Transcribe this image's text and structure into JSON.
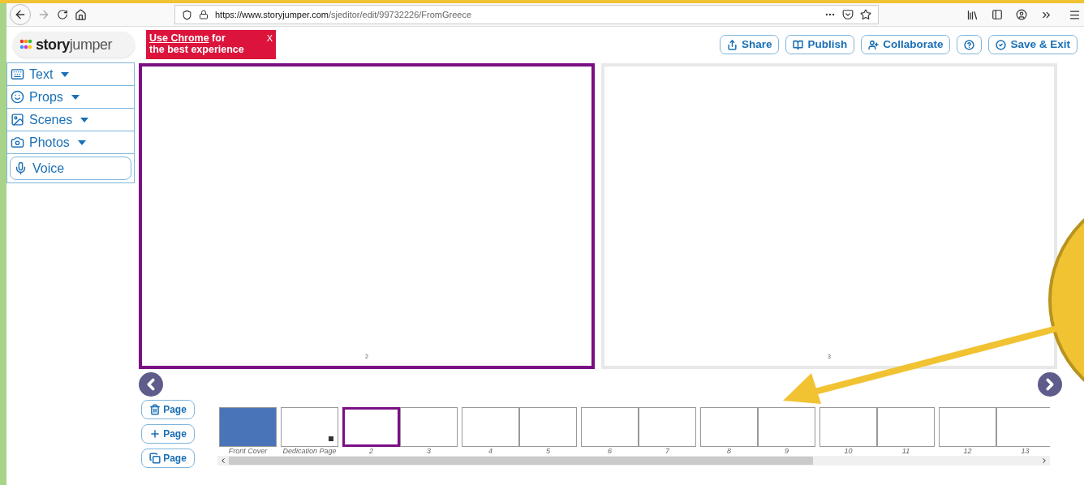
{
  "browser": {
    "url_host": "https://www.storyjumper.com",
    "url_path": "/sjeditor/edit/99732226/FromGreece"
  },
  "banner": {
    "link": "Use Chrome",
    "text_1": " for",
    "text_2": "the best experience",
    "close": "X"
  },
  "logo": {
    "word_1": "story",
    "word_2": "jumper"
  },
  "top_buttons": [
    {
      "kind": "share",
      "label": "Share"
    },
    {
      "kind": "publish",
      "label": "Publish"
    },
    {
      "kind": "collaborate",
      "label": "Collaborate"
    },
    {
      "kind": "help"
    },
    {
      "kind": "save",
      "label": "Save & Exit"
    }
  ],
  "tools": [
    {
      "kind": "text",
      "label": "Text",
      "dropdown": true
    },
    {
      "kind": "props",
      "label": "Props",
      "dropdown": true
    },
    {
      "kind": "scenes",
      "label": "Scenes",
      "dropdown": true
    },
    {
      "kind": "photos",
      "label": "Photos",
      "dropdown": true
    },
    {
      "kind": "voice",
      "label": "Voice",
      "dropdown": false
    }
  ],
  "spread": [
    {
      "number": "2",
      "selected": true
    },
    {
      "number": "3",
      "selected": false
    }
  ],
  "page_buttons": [
    {
      "kind": "delete",
      "label": "Page"
    },
    {
      "kind": "add",
      "label": "Page"
    },
    {
      "kind": "copy",
      "label": "Page"
    }
  ],
  "thumbnails": [
    {
      "kind": "cover",
      "label": "Front Cover",
      "selected": false
    },
    {
      "kind": "dedication",
      "label": "Dedication Page",
      "selected": false
    },
    {
      "kind": "page",
      "label": "2",
      "selected": true
    },
    {
      "kind": "page",
      "label": "3",
      "selected": false
    },
    {
      "kind": "page",
      "label": "4",
      "selected": false
    },
    {
      "kind": "page",
      "label": "5",
      "selected": false
    },
    {
      "kind": "page",
      "label": "6",
      "selected": false
    },
    {
      "kind": "page",
      "label": "7",
      "selected": false
    },
    {
      "kind": "page",
      "label": "8",
      "selected": false
    },
    {
      "kind": "page",
      "label": "9",
      "selected": false
    },
    {
      "kind": "page",
      "label": "10",
      "selected": false
    },
    {
      "kind": "page",
      "label": "11",
      "selected": false
    },
    {
      "kind": "page",
      "label": "12",
      "selected": false
    },
    {
      "kind": "page",
      "label": "13",
      "selected": false
    }
  ]
}
